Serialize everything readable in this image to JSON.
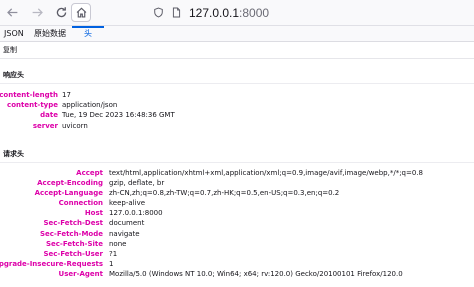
{
  "browser": {
    "url_host": "127.0.0.1",
    "url_port": ":8000"
  },
  "tabs": [
    {
      "label": "JSON"
    },
    {
      "label": "原始数据"
    },
    {
      "label": "头"
    }
  ],
  "toolbar": {
    "copy_label": "复制"
  },
  "response_headers": {
    "title": "响应头",
    "rows": [
      {
        "name": "content-length",
        "value": "17"
      },
      {
        "name": "content-type",
        "value": "application/json"
      },
      {
        "name": "date",
        "value": "Tue, 19 Dec 2023 16:48:36 GMT"
      },
      {
        "name": "server",
        "value": "uvicorn"
      }
    ]
  },
  "request_headers": {
    "title": "请求头",
    "rows": [
      {
        "name": "Accept",
        "value": "text/html,application/xhtml+xml,application/xml;q=0.9,image/avif,image/webp,*/*;q=0.8"
      },
      {
        "name": "Accept-Encoding",
        "value": "gzip, deflate, br"
      },
      {
        "name": "Accept-Language",
        "value": "zh-CN,zh;q=0.8,zh-TW;q=0.7,zh-HK;q=0.5,en-US;q=0.3,en;q=0.2"
      },
      {
        "name": "Connection",
        "value": "keep-alive"
      },
      {
        "name": "Host",
        "value": "127.0.0.1:8000"
      },
      {
        "name": "Sec-Fetch-Dest",
        "value": "document"
      },
      {
        "name": "Sec-Fetch-Mode",
        "value": "navigate"
      },
      {
        "name": "Sec-Fetch-Site",
        "value": "none"
      },
      {
        "name": "Sec-Fetch-User",
        "value": "?1"
      },
      {
        "name": "Upgrade-Insecure-Requests",
        "value": "1"
      },
      {
        "name": "User-Agent",
        "value": "Mozilla/5.0 (Windows NT 10.0; Win64; x64; rv:120.0) Gecko/20100101 Firefox/120.0"
      }
    ]
  },
  "colors": {
    "header_name": "#dd00a9",
    "active_tab": "#0061e0"
  }
}
